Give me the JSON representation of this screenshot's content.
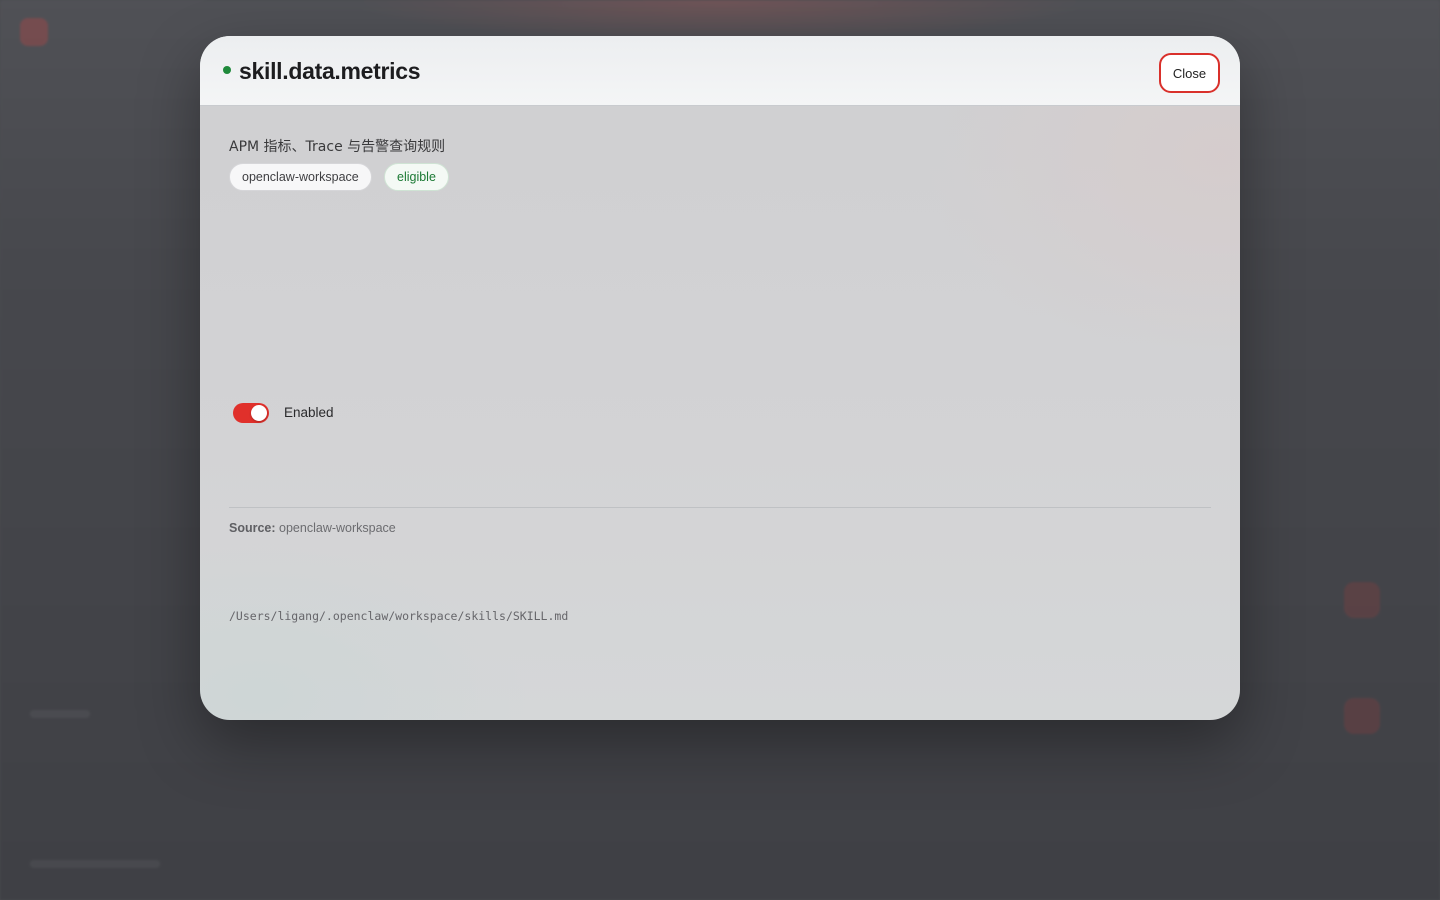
{
  "skill": {
    "name": "skill.data.metrics",
    "status_color": "#1f8a3b",
    "description": "APM 指标、Trace 与告警查询规则",
    "badges": {
      "source": "openclaw-workspace",
      "eligibility": "eligible"
    }
  },
  "header": {
    "close_label": "Close"
  },
  "toggle": {
    "label": "Enabled",
    "state": "on",
    "color": "#e0302b"
  },
  "meta": {
    "source_key": "Source:",
    "source_value": "openclaw-workspace",
    "path": "/Users/ligang/.openclaw/workspace/skills/SKILL.md"
  }
}
